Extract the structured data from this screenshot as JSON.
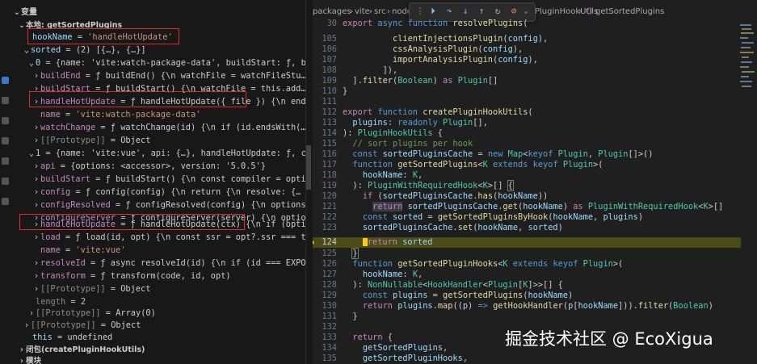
{
  "variables_panel": {
    "header": "变量",
    "scope_local": "本地: getSortedPlugins",
    "rows": {
      "hookName": {
        "name": "hookName",
        "value": "'handleHotUpdate'"
      },
      "sorted": {
        "name": "sorted",
        "value": "(2) [{…}, {…}]"
      },
      "item0": {
        "name": "0",
        "value": "{name: 'vite:watch-package-data', buildStart: ƒ, buildEnd: ƒ,…"
      },
      "buildEnd": {
        "name": "buildEnd",
        "value": "ƒ buildEnd() {\\n            watchFile = watchFileStu…"
      },
      "buildStart0": {
        "name": "buildStart",
        "value": "ƒ buildStart() {\\n            watchFile = this.add…"
      },
      "handleHotUpdate0": {
        "name": "handleHotUpdate",
        "value": "ƒ handleHotUpdate({ file }) {\\n            endsWith…"
      },
      "name0": {
        "name": "name",
        "value": "'vite:watch-package-data'"
      },
      "watchChange": {
        "name": "watchChange",
        "value": "ƒ watchChange(id) {\\n            if (id.endsWith(…"
      },
      "proto0": {
        "name": "[[Prototype]]",
        "value": "Object"
      },
      "item1": {
        "name": "1",
        "value": "{name: 'vite:vue', api: {…}, handleHotUpdate: ƒ, config: ƒ, c…"
      },
      "api": {
        "name": "api",
        "value": "{options: <accessor>, version: '5.0.5'}"
      },
      "buildStart1": {
        "name": "buildStart",
        "value": "ƒ buildStart() {\\n        const compiler = options.val…"
      },
      "config": {
        "name": "config",
        "value": "ƒ config(config) {\\n        return {\\n        resolve: {…"
      },
      "configResolved": {
        "name": "configResolved",
        "value": "ƒ configResolved(config) {\\n        options.valu…"
      },
      "configureServer": {
        "name": "configureServer",
        "value": "ƒ configureServer(server) {\\n        options.v…"
      },
      "handleHotUpdate1": {
        "name": "handleHotUpdate",
        "value": "ƒ handleHotUpdate(ctx) {\\n        if (options.v…"
      },
      "load": {
        "name": "load",
        "value": "ƒ load(id, opt) {\\n        const ssr = opt?.ssr === true;\\…"
      },
      "name1": {
        "name": "name",
        "value": "'vite:vue'"
      },
      "resolveId": {
        "name": "resolveId",
        "value": "ƒ async resolveId(id) {\\n        if (id === EXPORT_HE…"
      },
      "transform": {
        "name": "transform",
        "value": "ƒ transform(code, id, opt)"
      },
      "proto1": {
        "name": "[[Prototype]]",
        "value": "Object"
      },
      "length": {
        "name": "length",
        "value": "2"
      },
      "proto_arr": {
        "name": "[[Prototype]]",
        "value": "Array(0)"
      },
      "proto_obj": {
        "name": "[[Prototype]]",
        "value": "Object"
      },
      "this": {
        "name": "this",
        "value": "undefined"
      }
    },
    "scope_closure": "闭包(createPluginHookUtils)",
    "scope_module": "模块"
  },
  "editor": {
    "breadcrumb": {
      "seg1": "packages",
      "seg2": "vite",
      "seg3": "src",
      "seg4": "node",
      "seg5": "PluginHookUtils",
      "seg6": "getSortedPlugins"
    },
    "debug_toolbar": {
      "continue": "⏵",
      "step_over": "↷",
      "step_into": "↓",
      "step_out": "↑",
      "restart": "↻",
      "disconnect": "⊘"
    },
    "current_line": 124
  },
  "watermark": "掘金技术社区 @ EcoXigua",
  "colors": {
    "highlight_box": "#e12d2d",
    "current_line_bg": "#4b4b18",
    "breakpoint": "#ffcc00"
  }
}
